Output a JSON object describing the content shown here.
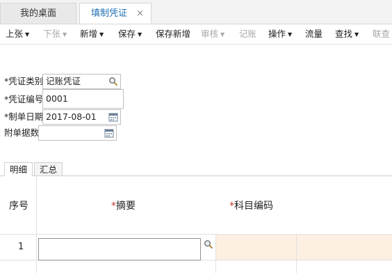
{
  "tabs": [
    {
      "label": "我的桌面"
    },
    {
      "label": "填制凭证",
      "close": "×"
    }
  ],
  "toolbar": {
    "items": [
      {
        "label": "上张",
        "caret": "▼"
      },
      {
        "label": "下张",
        "caret": "▼"
      },
      {
        "label": "新增",
        "caret": "▼"
      },
      {
        "label": "保存",
        "caret": "▼"
      },
      {
        "label": "保存新增"
      },
      {
        "label": "审核",
        "caret": "▼"
      },
      {
        "label": "记账"
      },
      {
        "label": "操作",
        "caret": "▼"
      },
      {
        "label": "流量"
      },
      {
        "label": "查找",
        "caret": "▼"
      },
      {
        "label": "联查"
      }
    ]
  },
  "form": {
    "voucher_type": {
      "label": "*凭证类别",
      "value": "记账凭证",
      "icon": "search-icon"
    },
    "voucher_number": {
      "label": "*凭证编号",
      "value": "0001"
    },
    "voucher_date": {
      "label": "*制单日期",
      "value": "2017-08-01",
      "icon": "calendar-icon"
    },
    "attachments": {
      "label": "附单据数",
      "value": "",
      "icon": "calendar-icon"
    }
  },
  "subtabs": [
    {
      "label": "明细"
    },
    {
      "label": "汇总"
    }
  ],
  "grid": {
    "columns": [
      {
        "label": "序号"
      },
      {
        "label": "摘要",
        "star": "*"
      },
      {
        "label": "科目编码",
        "star": "*"
      }
    ],
    "rows": [
      {
        "index": "1",
        "summary": "",
        "account_code": ""
      }
    ]
  },
  "colors": {
    "accent": "#1f6fb2",
    "row_highlight": "#fdefe1",
    "required_star": "#c0392b"
  }
}
